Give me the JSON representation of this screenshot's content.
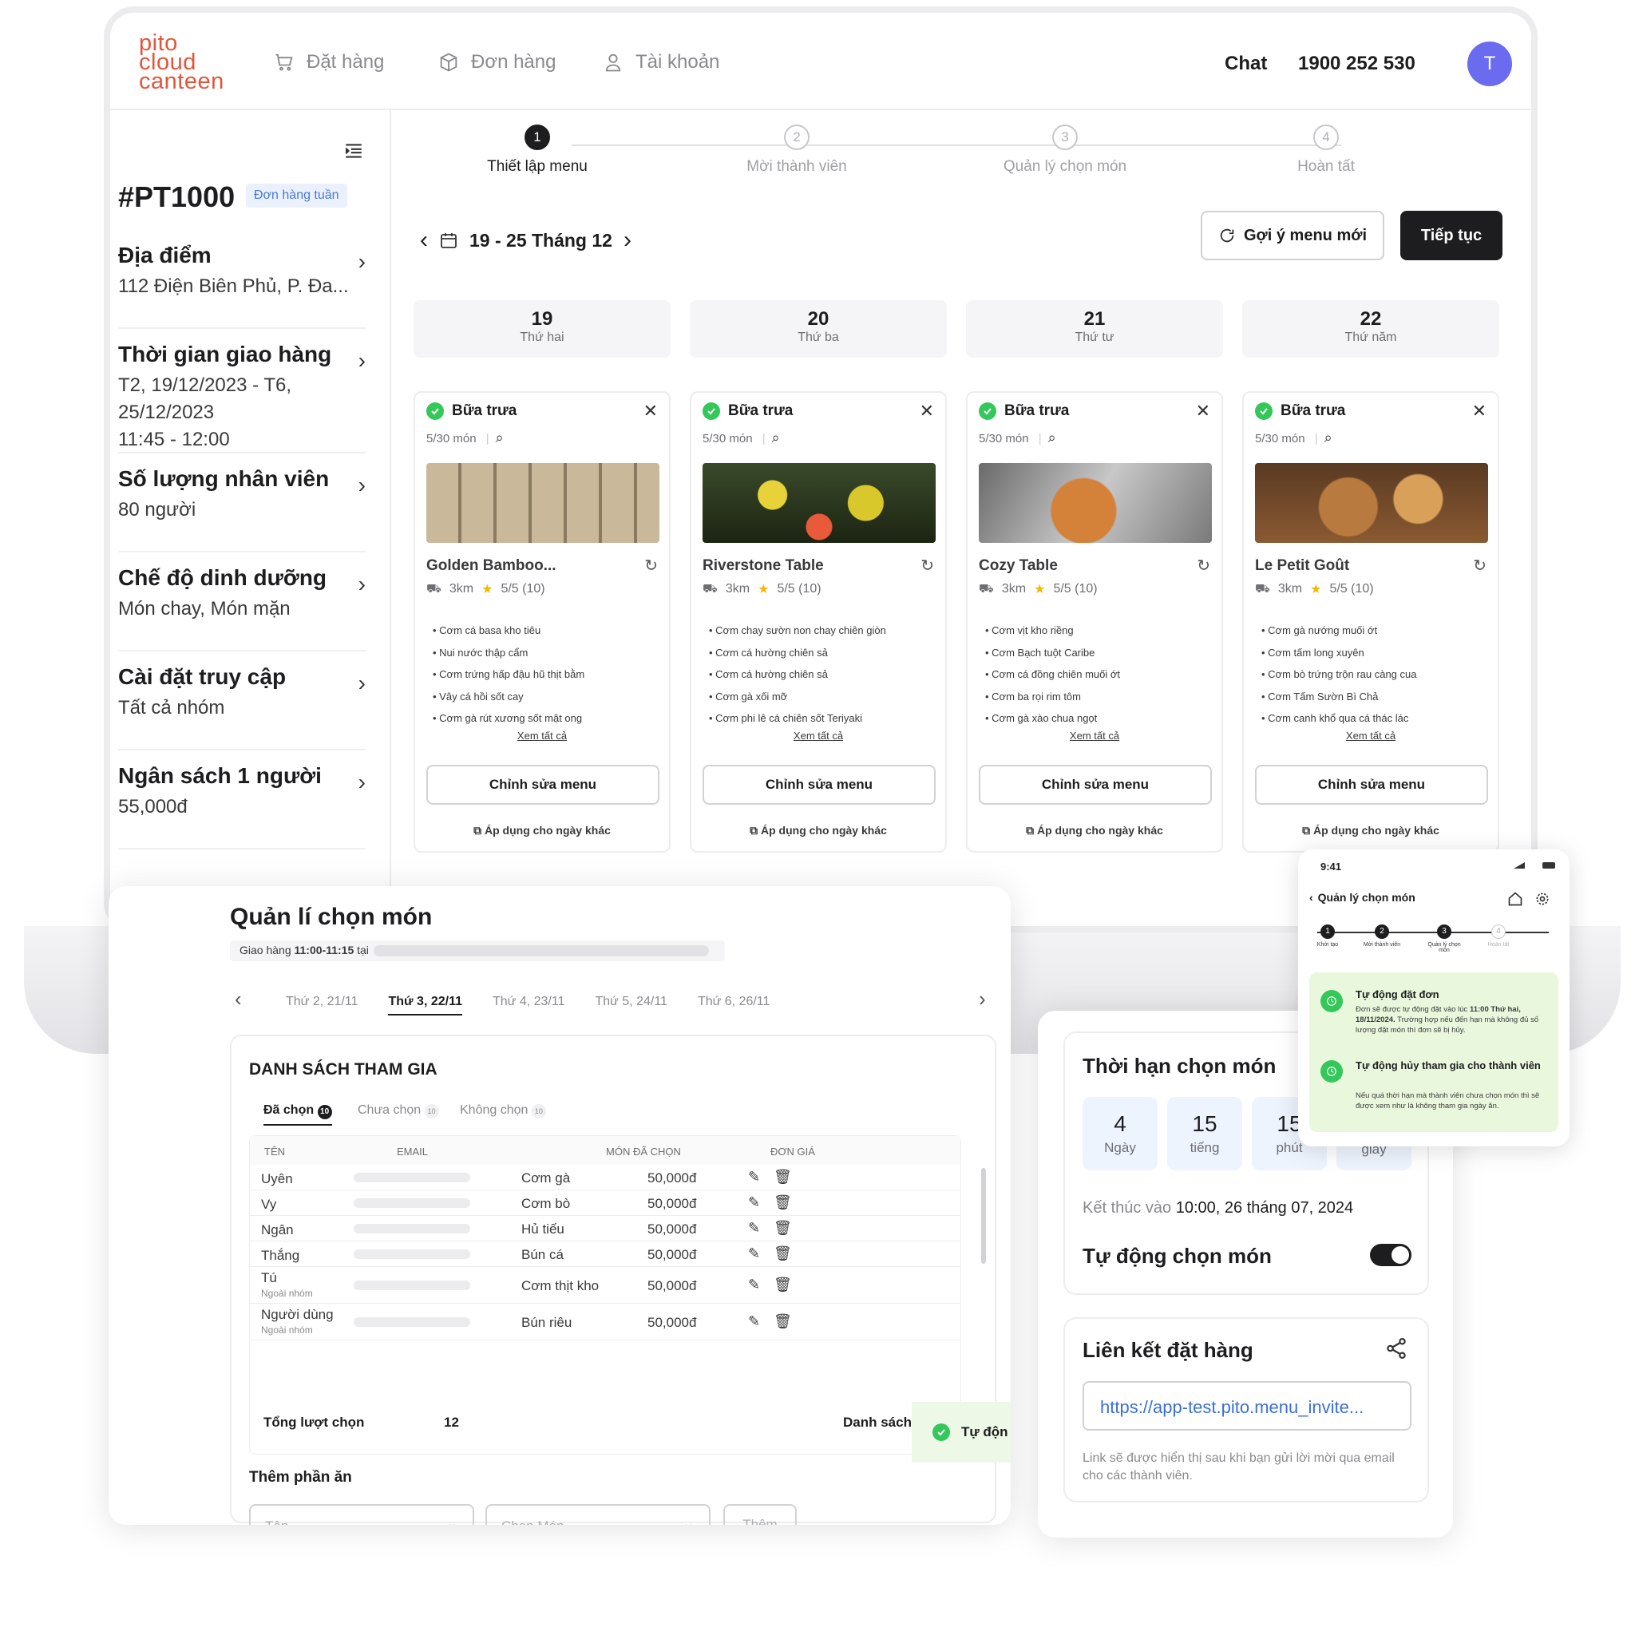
{
  "nav": {
    "logo": [
      "pito",
      "cloud",
      "canteen"
    ],
    "order": "Đặt hàng",
    "orders": "Đơn hàng",
    "account": "Tài khoản",
    "chat": "Chat",
    "phone": "1900 252 530",
    "avatar": "T"
  },
  "sidebar": {
    "order_id": "#PT1000",
    "badge": "Đơn hàng tuần",
    "items": [
      {
        "title": "Địa điểm",
        "value": "112 Điện Biên Phủ, P. Đa..."
      },
      {
        "title": "Thời gian giao hàng",
        "value": "T2, 19/12/2023 - T6, 25/12/2023",
        "value2": "11:45 - 12:00"
      },
      {
        "title": "Số lượng nhân viên",
        "value": "80 người"
      },
      {
        "title": "Chế độ dinh dưỡng",
        "value": "Món chay, Món mặn"
      },
      {
        "title": "Cài đặt truy cập",
        "value": "Tất cả nhóm"
      },
      {
        "title": "Ngân sách 1 người",
        "value": "55,000đ"
      }
    ]
  },
  "steps": [
    {
      "n": "1",
      "label": "Thiết lập menu"
    },
    {
      "n": "2",
      "label": "Mời thành viên"
    },
    {
      "n": "3",
      "label": "Quản lý chọn món"
    },
    {
      "n": "4",
      "label": "Hoàn tất"
    }
  ],
  "week": {
    "range": "19 - 25 Tháng 12",
    "suggest": "Gợi ý menu mới",
    "continue": "Tiếp tục"
  },
  "days": [
    {
      "n": "19",
      "w": "Thứ hai"
    },
    {
      "n": "20",
      "w": "Thứ ba"
    },
    {
      "n": "21",
      "w": "Thứ tư"
    },
    {
      "n": "22",
      "w": "Thứ năm"
    }
  ],
  "cards": [
    {
      "meal": "Bữa trưa",
      "count": "5/30 món",
      "restaurant": "Golden Bamboo...",
      "distance": "3km",
      "rating": "5/5 (10)",
      "dishes": [
        "Cơm cá basa kho tiêu",
        "Nui nước thập cẩm",
        "Cơm trứng hấp đậu hũ thịt bằm",
        "Vây cá hồi sốt cay",
        "Cơm gà rút xương sốt mật ong"
      ],
      "see_all": "Xem tất cả",
      "edit": "Chỉnh sửa menu",
      "apply": "Áp dụng cho ngày khác"
    },
    {
      "meal": "Bữa trưa",
      "count": "5/30 món",
      "restaurant": "Riverstone Table",
      "distance": "3km",
      "rating": "5/5 (10)",
      "dishes": [
        "Cơm chay sườn non chay chiên giòn",
        "Cơm cá hường chiên sả",
        "Cơm cá hường chiên sả",
        "Cơm gà xối mỡ",
        "Cơm phi lê cá chiên sốt Teriyaki"
      ],
      "see_all": "Xem tất cả",
      "edit": "Chỉnh sửa menu",
      "apply": "Áp dụng cho ngày khác"
    },
    {
      "meal": "Bữa trưa",
      "count": "5/30 món",
      "restaurant": "Cozy Table",
      "distance": "3km",
      "rating": "5/5 (10)",
      "dishes": [
        "Cơm vịt kho riềng",
        "Cơm Bạch tuột Caribe",
        "Cơm cá đồng chiên muối ớt",
        "Cơm ba rọi rim tôm",
        "Cơm gà xào chua ngọt"
      ],
      "see_all": "Xem tất cả",
      "edit": "Chỉnh sửa menu",
      "apply": "Áp dụng cho ngày khác"
    },
    {
      "meal": "Bữa trưa",
      "count": "5/30 món",
      "restaurant": "Le Petit Goût",
      "distance": "3km",
      "rating": "5/5 (10)",
      "dishes": [
        "Cơm gà nướng muối ớt",
        "Cơm tấm long xuyên",
        "Cơm bò trứng trộn rau càng cua",
        "Cơm Tấm Sườn Bì Chả",
        "Cơm canh khổ qua cá thác lác"
      ],
      "see_all": "Xem tất cả",
      "edit": "Chỉnh sửa menu",
      "apply": "Áp dụng cho ngày khác"
    }
  ],
  "manage": {
    "title": "Quản lí chọn món",
    "delivery_prefix": "Giao hàng",
    "delivery_time": "11:00-11:15",
    "delivery_suffix": "tại",
    "tabs": [
      "Thứ 2, 21/11",
      "Thứ 3, 22/11",
      "Thứ 4, 23/11",
      "Thứ 5, 24/11",
      "Thứ 6, 26/11"
    ],
    "list_title": "DANH SÁCH THAM GIA",
    "subtabs": [
      {
        "label": "Đã chọn",
        "count": "10"
      },
      {
        "label": "Chưa chọn",
        "count": "10"
      },
      {
        "label": "Không chọn",
        "count": "10"
      }
    ],
    "columns": [
      "TÊN",
      "EMAIL",
      "MÓN ĐÃ CHỌN",
      "ĐƠN GIÁ"
    ],
    "rows": [
      {
        "name": "Uyên",
        "sub": "",
        "dish": "Cơm gà",
        "price": "50,000đ"
      },
      {
        "name": "Vy",
        "sub": "",
        "dish": "Cơm bò",
        "price": "50,000đ"
      },
      {
        "name": "Ngân",
        "sub": "",
        "dish": "Hủ tiếu",
        "price": "50,000đ"
      },
      {
        "name": "Thắng",
        "sub": "",
        "dish": "Bún cá",
        "price": "50,000đ"
      },
      {
        "name": "Tú",
        "sub": "Ngoài nhóm",
        "dish": "Cơm thịt kho",
        "price": "50,000đ"
      },
      {
        "name": "Người dùng",
        "sub": "Ngoài nhóm",
        "dish": "Bún riêu",
        "price": "50,000đ"
      }
    ],
    "total_label": "Tổng lượt chọn",
    "total": "12",
    "list_link": "Danh sách",
    "toast": "Tự độn",
    "add_title": "Thêm phần ăn",
    "name_ph": "Tên",
    "dish_ph": "Chọn Món",
    "add_btn": "Thêm"
  },
  "deadline": {
    "title": "Thời hạn chọn món",
    "values": [
      {
        "n": "4",
        "u": "Ngày"
      },
      {
        "n": "15",
        "u": "tiếng"
      },
      {
        "n": "15",
        "u": "phút"
      },
      {
        "n": "",
        "u": "giây"
      }
    ],
    "end_prefix": "Kết thúc vào",
    "end": "10:00, 26 tháng 07, 2024",
    "auto": "Tự động chọn món"
  },
  "link": {
    "title": "Liên kết đặt hàng",
    "url": "https://app-test.pito.menu_invite...",
    "note": "Link sẽ được hiển thị sau khi bạn gửi lời mời qua email cho các thành viên."
  },
  "phone": {
    "time": "9:41",
    "title": "Quản lý chọn món",
    "steps": [
      "Khởi tạo",
      "Mời thành viên",
      "Quản lý chọn món",
      "Hoàn tất"
    ],
    "auto_order_title": "Tự động đặt đơn",
    "auto_order_text_a": "Đơn sẽ được tự động đặt vào lúc",
    "auto_order_time": "11:00 Thứ hai, 18/11/2024.",
    "auto_order_text_b": "Trường hợp nếu đến hạn mà không đủ số lượng đặt món thì đơn sẽ bị hủy.",
    "auto_cancel_title": "Tự động hủy tham gia cho thành viên",
    "auto_cancel_text": "Nếu quá thời hạn mà thành viên chưa chọn món thì sẽ được xem như là không tham gia ngày ăn."
  },
  "colors": {
    "brand": "#e2553b",
    "accent": "#6b6bf0",
    "success": "#34c759",
    "dark": "#1d1d1f"
  }
}
